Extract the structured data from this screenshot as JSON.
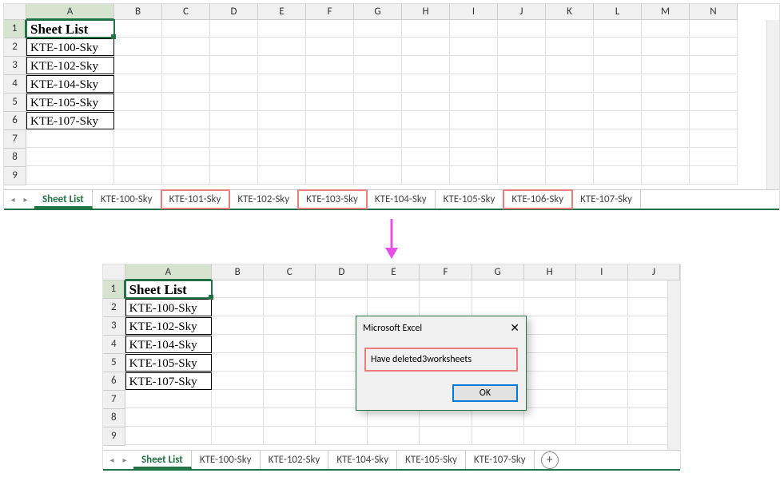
{
  "top": {
    "columns": [
      "A",
      "B",
      "C",
      "D",
      "E",
      "F",
      "G",
      "H",
      "I",
      "J",
      "K",
      "L",
      "M",
      "N"
    ],
    "col_a_width": 110,
    "other_col_width": 60,
    "rows": [
      {
        "n": "1",
        "a": "Sheet List",
        "hdr": true
      },
      {
        "n": "2",
        "a": "KTE-100-Sky"
      },
      {
        "n": "3",
        "a": "KTE-102-Sky"
      },
      {
        "n": "4",
        "a": "KTE-104-Sky"
      },
      {
        "n": "5",
        "a": "KTE-105-Sky"
      },
      {
        "n": "6",
        "a": "KTE-107-Sky"
      },
      {
        "n": "7",
        "a": ""
      },
      {
        "n": "8",
        "a": ""
      },
      {
        "n": "9",
        "a": ""
      }
    ],
    "tabs": [
      {
        "label": "Sheet List",
        "active": true,
        "hl": false
      },
      {
        "label": "KTE-100-Sky",
        "active": false,
        "hl": false
      },
      {
        "label": "KTE-101-Sky",
        "active": false,
        "hl": true
      },
      {
        "label": "KTE-102-Sky",
        "active": false,
        "hl": false
      },
      {
        "label": "KTE-103-Sky",
        "active": false,
        "hl": true
      },
      {
        "label": "KTE-104-Sky",
        "active": false,
        "hl": false
      },
      {
        "label": "KTE-105-Sky",
        "active": false,
        "hl": false
      },
      {
        "label": "KTE-106-Sky",
        "active": false,
        "hl": true
      },
      {
        "label": "KTE-107-Sky",
        "active": false,
        "hl": false
      }
    ]
  },
  "bottom": {
    "columns": [
      "A",
      "B",
      "C",
      "D",
      "E",
      "F",
      "G",
      "H",
      "I",
      "J"
    ],
    "col_a_width": 110,
    "other_col_width": 66,
    "rows": [
      {
        "n": "1",
        "a": "Sheet List",
        "hdr": true
      },
      {
        "n": "2",
        "a": "KTE-100-Sky"
      },
      {
        "n": "3",
        "a": "KTE-102-Sky"
      },
      {
        "n": "4",
        "a": "KTE-104-Sky"
      },
      {
        "n": "5",
        "a": "KTE-105-Sky"
      },
      {
        "n": "6",
        "a": "KTE-107-Sky"
      },
      {
        "n": "7",
        "a": ""
      },
      {
        "n": "8",
        "a": ""
      },
      {
        "n": "9",
        "a": ""
      }
    ],
    "tabs": [
      {
        "label": "Sheet List",
        "active": true
      },
      {
        "label": "KTE-100-Sky",
        "active": false
      },
      {
        "label": "KTE-102-Sky",
        "active": false
      },
      {
        "label": "KTE-104-Sky",
        "active": false
      },
      {
        "label": "KTE-105-Sky",
        "active": false
      },
      {
        "label": "KTE-107-Sky",
        "active": false
      }
    ]
  },
  "dialog": {
    "title": "Microsoft Excel",
    "message": "Have deleted3worksheets",
    "ok": "OK"
  },
  "icons": {
    "nav_prev": "◂",
    "nav_next": "▸",
    "close": "✕",
    "plus": "+"
  },
  "colors": {
    "accent": "#217346",
    "highlight": "#ed7d7d",
    "button_focus": "#0078d7",
    "arrow": "#e84fe8"
  }
}
